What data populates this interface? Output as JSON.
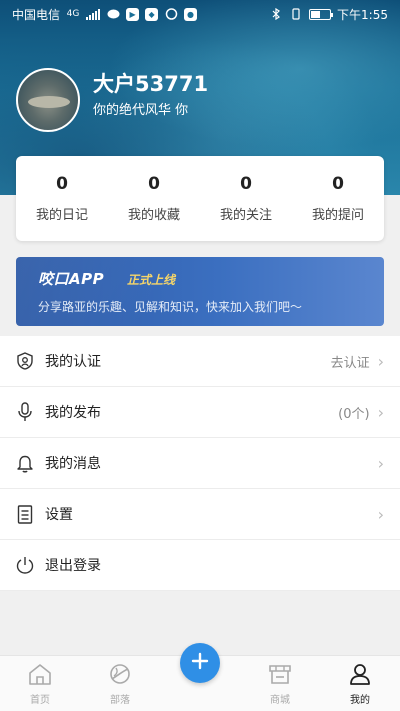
{
  "status_bar": {
    "carrier": "中国电信",
    "network": "4G",
    "time": "下午1:55",
    "battery_level": 0.5
  },
  "profile": {
    "username": "大户53771",
    "signature": "你的绝代风华 你"
  },
  "stats": [
    {
      "value": "0",
      "label": "我的日记"
    },
    {
      "value": "0",
      "label": "我的收藏"
    },
    {
      "value": "0",
      "label": "我的关注"
    },
    {
      "value": "0",
      "label": "我的提问"
    }
  ],
  "banner": {
    "title": "咬口APP",
    "tag": "正式上线",
    "subtitle": "分享路亚的乐趣、见解和知识，快来加入我们吧～"
  },
  "menu": [
    {
      "icon": "certificate-icon",
      "label": "我的认证",
      "value": "去认证"
    },
    {
      "icon": "microphone-icon",
      "label": "我的发布",
      "value": "(0个)"
    },
    {
      "icon": "bell-icon",
      "label": "我的消息",
      "value": ""
    },
    {
      "icon": "list-icon",
      "label": "设置",
      "value": ""
    },
    {
      "icon": "power-icon",
      "label": "退出登录",
      "value": ""
    }
  ],
  "tabbar": [
    {
      "icon": "home-icon",
      "label": "首页",
      "active": false
    },
    {
      "icon": "planet-icon",
      "label": "部落",
      "active": false
    },
    {
      "icon": "store-icon",
      "label": "商城",
      "active": false
    },
    {
      "icon": "user-icon",
      "label": "我的",
      "active": true
    }
  ],
  "colors": {
    "accent": "#2f8fe6",
    "banner": "#3b6fc0",
    "banner_tag": "#f5d56a"
  }
}
